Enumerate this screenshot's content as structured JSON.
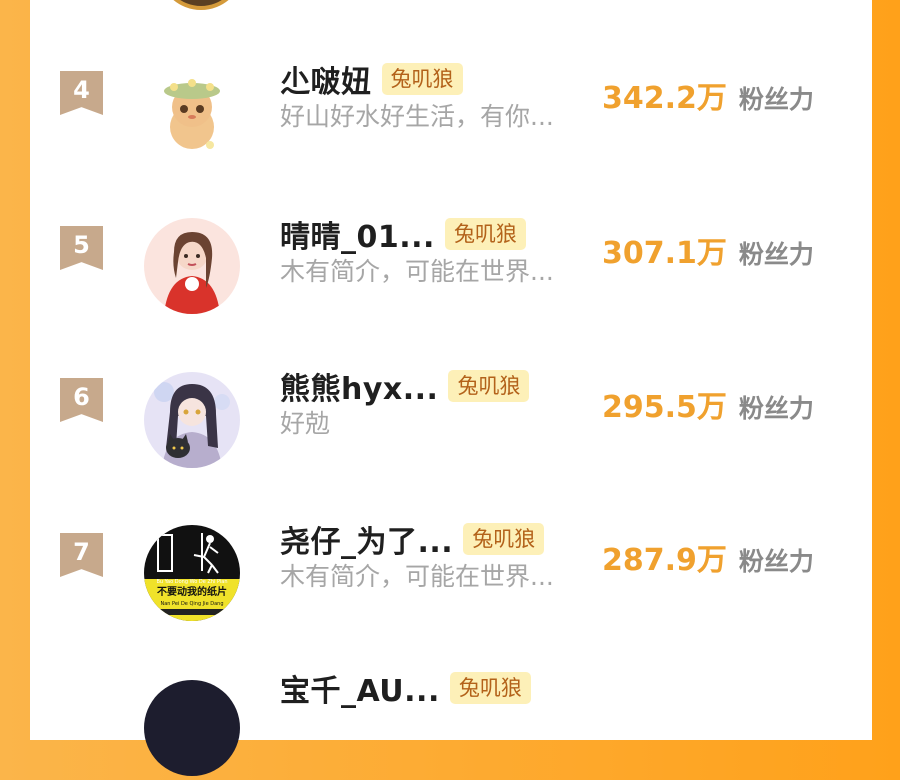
{
  "rows": [
    {
      "rank": "4",
      "name": "尐啵妞",
      "tag": "兔叽狼",
      "desc": "好山好水好生活，有你...",
      "value": "342.2万",
      "unit": "粉丝力",
      "avatar": "cartoon-hedgehog-avatar"
    },
    {
      "rank": "5",
      "name": "晴晴_01...",
      "tag": "兔叽狼",
      "desc": "木有简介，可能在世界...",
      "value": "307.1万",
      "unit": "粉丝力",
      "avatar": "girl-in-red-dress-avatar"
    },
    {
      "rank": "6",
      "name": "熊熊hyx...",
      "tag": "兔叽狼",
      "desc": "好勊",
      "value": "295.5万",
      "unit": "粉丝力",
      "avatar": "anime-girl-with-cat-avatar"
    },
    {
      "rank": "7",
      "name": "尧仔_为了...",
      "tag": "兔叽狼",
      "desc": "木有简介，可能在世界...",
      "value": "287.9万",
      "unit": "粉丝力",
      "avatar": "paper-figure-poster-avatar",
      "avatar_text": {
        "line1": "Bu Yao Dong Wo De Zhi Pian",
        "line2": "不要动我的纸片",
        "line3": "Nan Pei De Qing Jie Dang"
      }
    }
  ],
  "partial_bottom": {
    "name": "宝千_AU...",
    "tag": "兔叽狼"
  },
  "colors": {
    "background": "#ffa11a",
    "card": "#ffffff",
    "rank_badge": "#c7a98c",
    "score": "#f0a12e",
    "tag_bg": "#fdf0b8",
    "tag_text": "#b3621a"
  }
}
